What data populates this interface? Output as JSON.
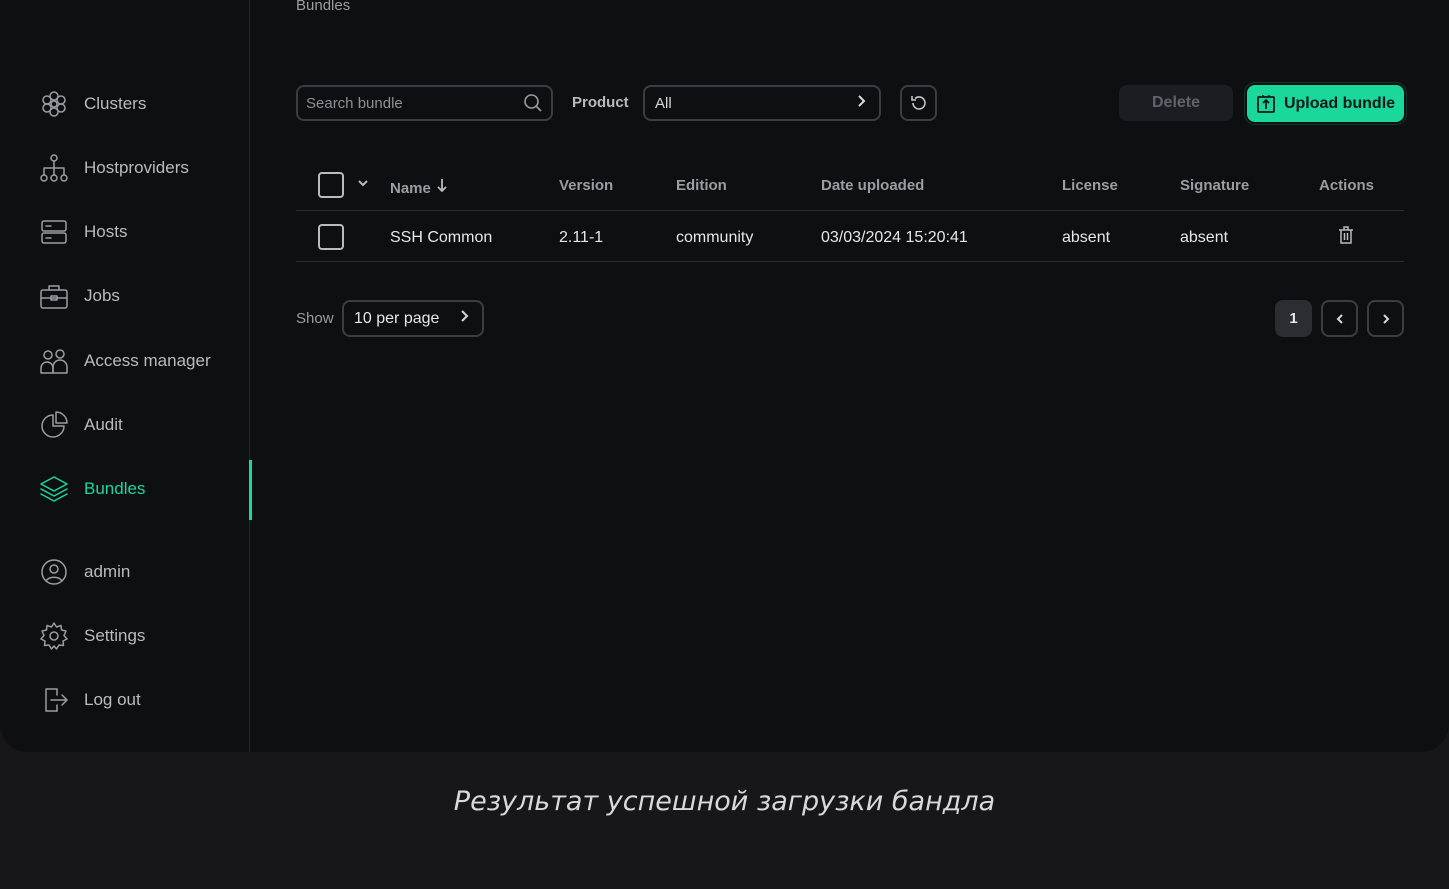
{
  "breadcrumb": "Bundles",
  "sidebar": {
    "items": [
      {
        "label": "Clusters",
        "icon": "clusters-icon"
      },
      {
        "label": "Hostproviders",
        "icon": "hostproviders-icon"
      },
      {
        "label": "Hosts",
        "icon": "hosts-icon"
      },
      {
        "label": "Jobs",
        "icon": "jobs-icon"
      },
      {
        "label": "Access manager",
        "icon": "access-manager-icon"
      },
      {
        "label": "Audit",
        "icon": "audit-icon"
      },
      {
        "label": "Bundles",
        "icon": "bundles-icon",
        "active": true
      }
    ],
    "bottom": [
      {
        "label": "admin",
        "icon": "user-icon"
      },
      {
        "label": "Settings",
        "icon": "gear-icon"
      },
      {
        "label": "Log out",
        "icon": "logout-icon"
      }
    ]
  },
  "toolbar": {
    "search_placeholder": "Search bundle",
    "product_label": "Product",
    "product_value": "All",
    "delete_label": "Delete",
    "upload_label": "Upload bundle"
  },
  "table": {
    "columns": [
      "Name",
      "Version",
      "Edition",
      "Date uploaded",
      "License",
      "Signature",
      "Actions"
    ],
    "rows": [
      {
        "name": "SSH Common",
        "version": "2.11-1",
        "edition": "community",
        "date": "03/03/2024 15:20:41",
        "license": "absent",
        "signature": "absent"
      }
    ]
  },
  "pagination": {
    "show_label": "Show",
    "per_page": "10 per page",
    "current_page": "1"
  },
  "caption": "Результат успешной загрузки бандла",
  "colors": {
    "accent": "#1ad79c",
    "background": "#0e0f12"
  }
}
